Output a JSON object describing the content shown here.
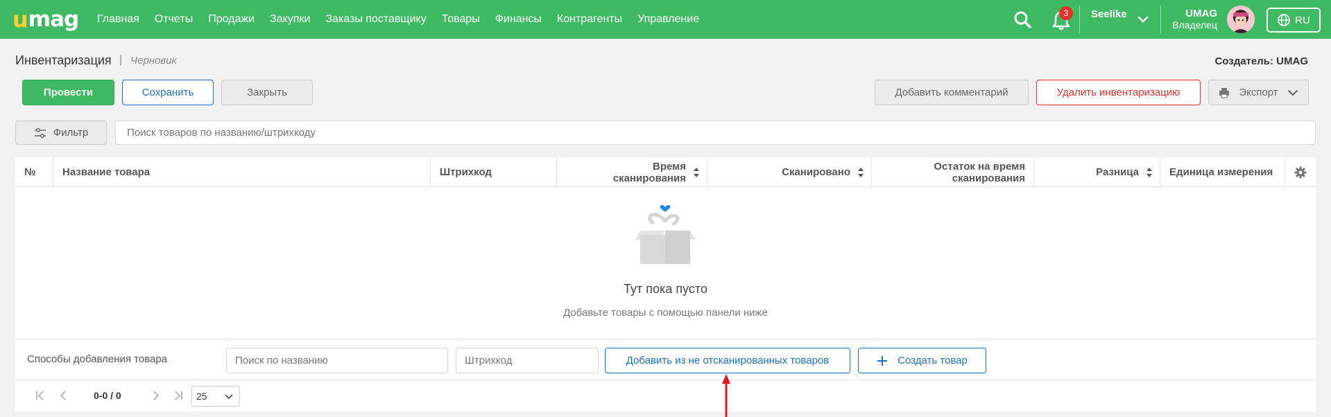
{
  "brand": {
    "logo": "umag",
    "accent": "#3dba62",
    "blue": "#1a6fc4",
    "red": "#e0312b"
  },
  "nav": [
    "Главная",
    "Отчеты",
    "Продажи",
    "Закупки",
    "Заказы поставщику",
    "Товары",
    "Финансы",
    "Контрагенты",
    "Управление"
  ],
  "topbar": {
    "notifications_count": "3",
    "store_name": "Seelike",
    "user_name": "UMAG",
    "user_role": "Владелец",
    "language": "RU"
  },
  "page": {
    "title": "Инвентаризация",
    "separator": "|",
    "status": "Черновик",
    "creator": "Создатель: UMAG"
  },
  "actions": {
    "conduct": "Провести",
    "save": "Сохранить",
    "close": "Закрыть",
    "add_comment": "Добавить комментарий",
    "delete": "Удалить инвентаризацию",
    "export": "Экспорт"
  },
  "filter": {
    "label": "Фильтр"
  },
  "search": {
    "placeholder": "Поиск товаров по названию/штрихкоду"
  },
  "table": {
    "columns": {
      "num": "№",
      "name": "Название товара",
      "barcode": "Штрихкод",
      "scan_time": "Время сканирования",
      "scanned": "Сканировано",
      "stock": "Остаток на время сканирования",
      "diff": "Разница",
      "unit": "Единица измерения"
    },
    "empty_title": "Тут пока пусто",
    "empty_subtitle": "Добавьте товары с помощью панели ниже"
  },
  "add_panel": {
    "label": "Способы добавления товара",
    "name_placeholder": "Поиск по названию",
    "barcode_placeholder": "Штрихкод",
    "add_unscanned": "Добавить из не отсканированных товаров",
    "create_product": "Создать товар"
  },
  "pagination": {
    "range": "0-0 / 0",
    "page_size": "25"
  }
}
